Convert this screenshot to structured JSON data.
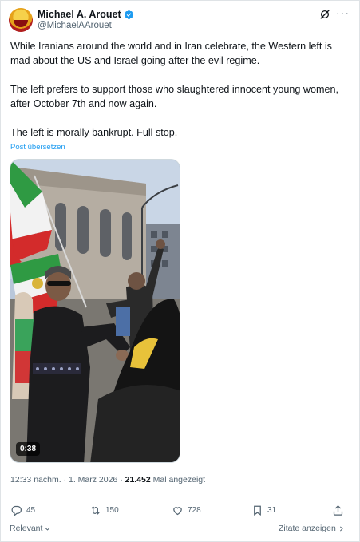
{
  "author": {
    "name": "Michael A. Arouet",
    "handle": "@MichaelAArouet"
  },
  "tweet": {
    "paragraphs": [
      "While Iranians around the world and in Iran celebrate, the Western left is mad about the US and Israel going after the evil regime.",
      "The left prefers to support those who slaughtered innocent young women, after October 7th and now again.",
      "The left is morally bankrupt. Full stop."
    ],
    "translate_label": "Post übersetzen"
  },
  "media": {
    "duration": "0:38"
  },
  "meta": {
    "time": "12:33 nachm.",
    "separator": "·",
    "date": "1. März 2026",
    "views_count": "21.452",
    "views_label": "Mal angezeigt"
  },
  "actions": {
    "replies": "45",
    "reposts": "150",
    "likes": "728",
    "bookmarks": "31"
  },
  "footer": {
    "sort_label": "Relevant",
    "quotes_label": "Zitate anzeigen"
  },
  "colors": {
    "accent": "#1d9bf0",
    "muted": "#536471",
    "text": "#0f1419"
  },
  "icons": [
    "verified-badge-icon",
    "grok-icon",
    "more-icon",
    "reply-icon",
    "repost-icon",
    "like-icon",
    "bookmark-icon",
    "share-icon",
    "chevron-down-icon",
    "chevron-right-icon"
  ]
}
